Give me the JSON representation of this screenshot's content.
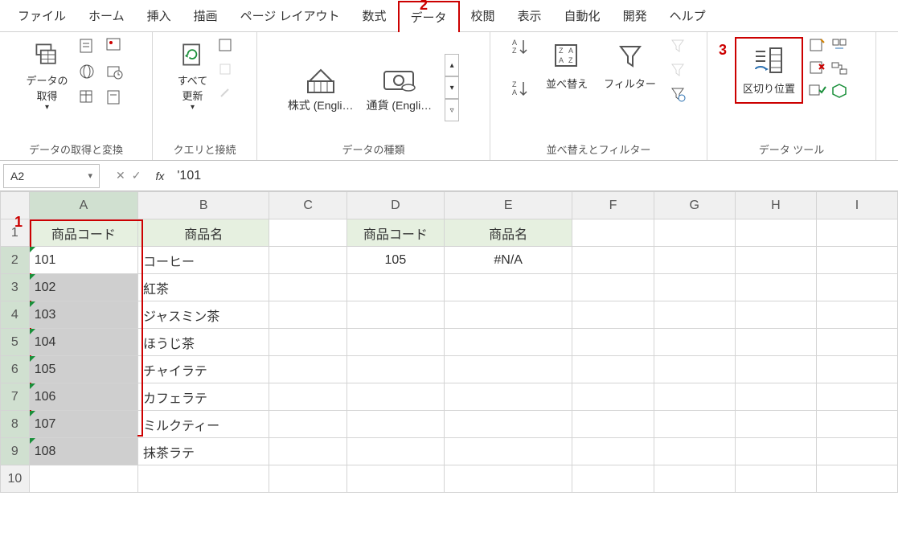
{
  "menu": {
    "tabs": [
      "ファイル",
      "ホーム",
      "挿入",
      "描画",
      "ページ レイアウト",
      "数式",
      "データ",
      "校閲",
      "表示",
      "自動化",
      "開発",
      "ヘルプ"
    ],
    "active_index": 6
  },
  "annotations": {
    "a1": "1",
    "a2": "2",
    "a3": "3"
  },
  "ribbon": {
    "group1": {
      "get_data": "データの\n取得",
      "label": "データの取得と変換"
    },
    "group2": {
      "refresh": "すべて\n更新",
      "label": "クエリと接続"
    },
    "group3": {
      "stock": "株式 (Engli…",
      "currency": "通貨 (Engli…",
      "label": "データの種類"
    },
    "group4": {
      "sort": "並べ替え",
      "filter": "フィルター",
      "label": "並べ替えとフィルター"
    },
    "group5": {
      "text_to_cols": "区切り位置",
      "label": "データ ツール"
    }
  },
  "formula_bar": {
    "cell_ref": "A2",
    "formula": "'101"
  },
  "columns": [
    "A",
    "B",
    "C",
    "D",
    "E",
    "F",
    "G",
    "H",
    "I"
  ],
  "rows": [
    "1",
    "2",
    "3",
    "4",
    "5",
    "6",
    "7",
    "8",
    "9",
    "10"
  ],
  "sheet": {
    "headers": {
      "A1": "商品コード",
      "B1": "商品名",
      "D1": "商品コード",
      "E1": "商品名"
    },
    "tableA": [
      {
        "code": "101",
        "name": "コーヒー"
      },
      {
        "code": "102",
        "name": "紅茶"
      },
      {
        "code": "103",
        "name": "ジャスミン茶"
      },
      {
        "code": "104",
        "name": "ほうじ茶"
      },
      {
        "code": "105",
        "name": "チャイラテ"
      },
      {
        "code": "106",
        "name": "カフェラテ"
      },
      {
        "code": "107",
        "name": "ミルクティー"
      },
      {
        "code": "108",
        "name": "抹茶ラテ"
      }
    ],
    "lookup": {
      "code": "105",
      "result": "#N/A"
    }
  }
}
